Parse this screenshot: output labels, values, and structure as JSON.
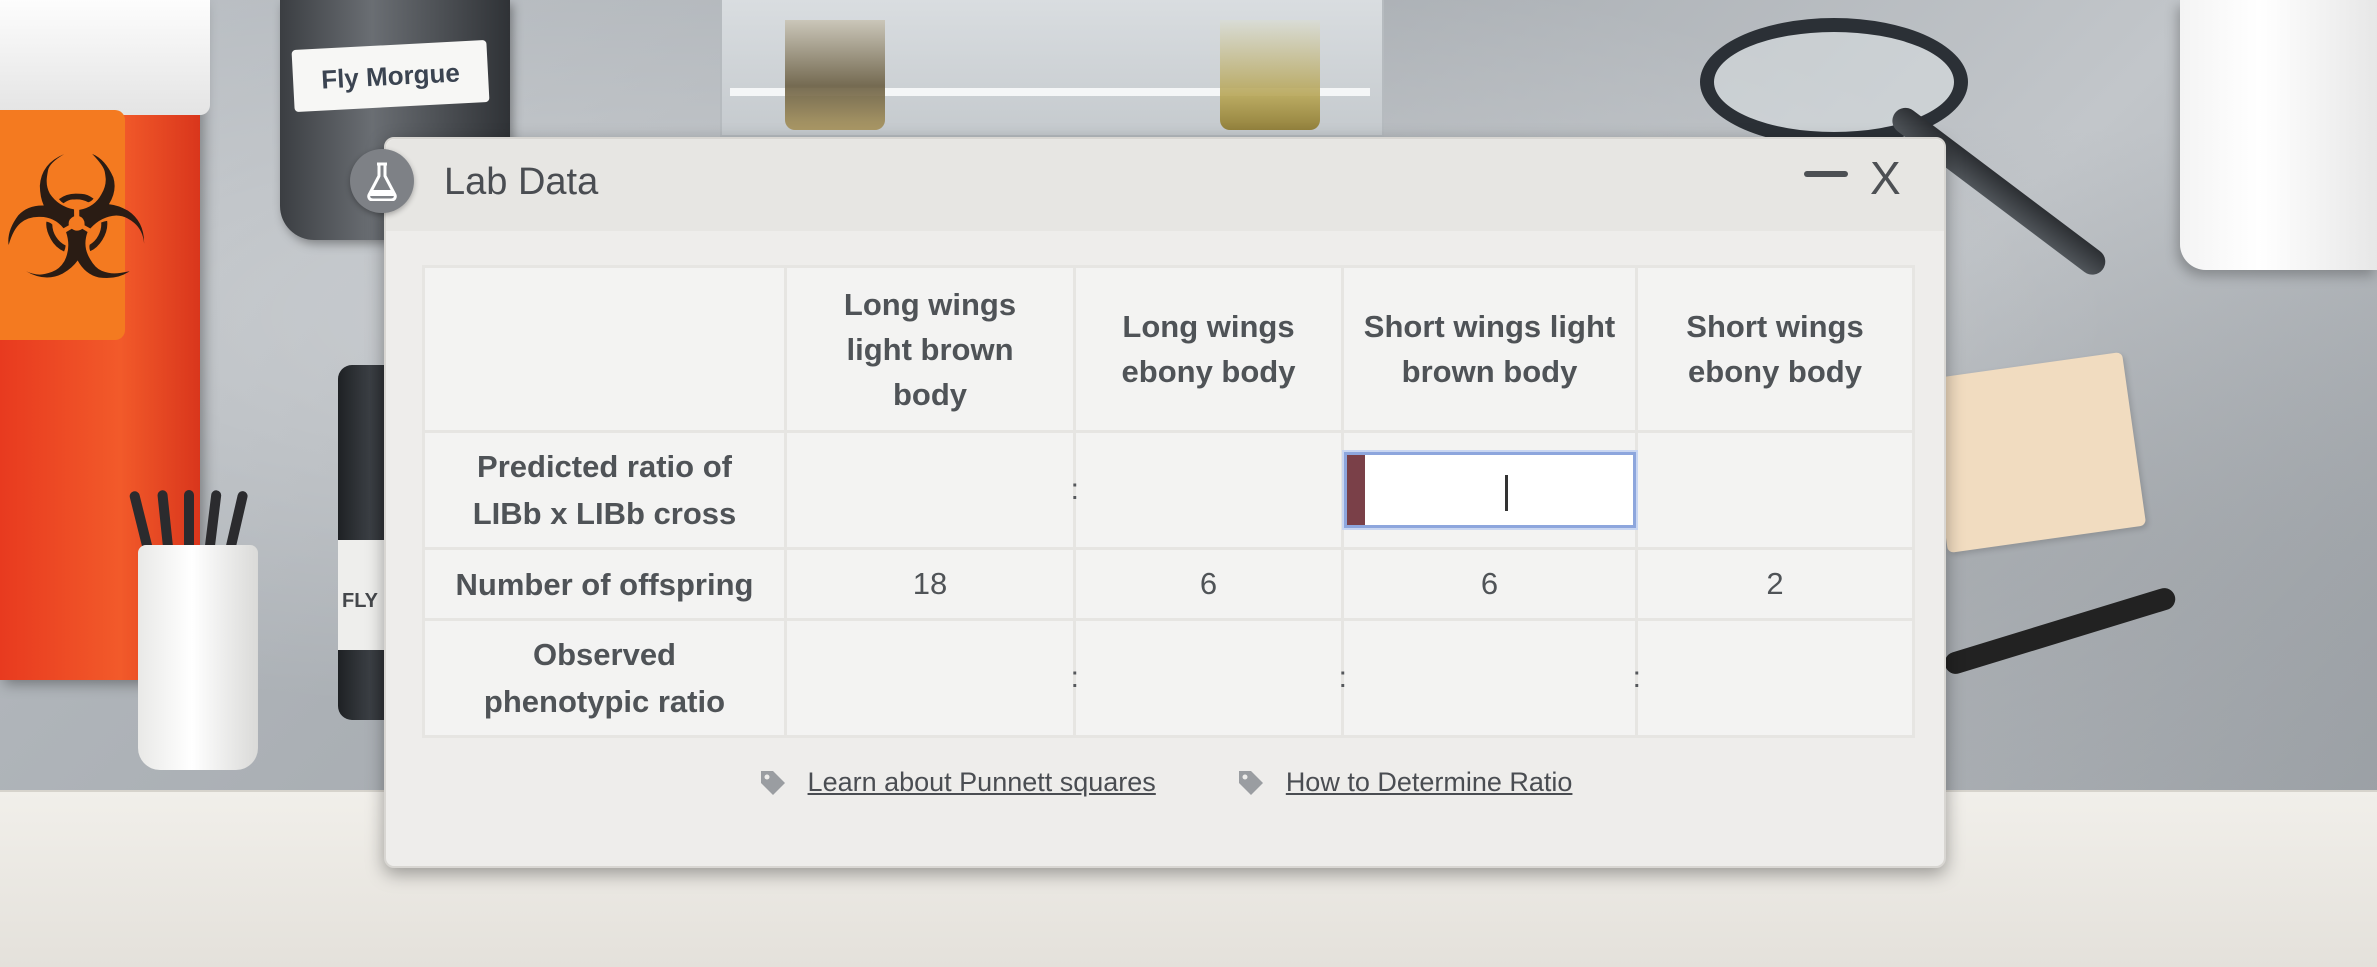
{
  "background": {
    "morgue_label": "Fly Morgue",
    "bottle_label": "FLY"
  },
  "dialog": {
    "title": "Lab Data",
    "icon": "flask-icon",
    "minimize_label": "—",
    "close_label": "X"
  },
  "table": {
    "columns": [
      "Long wings light brown body",
      "Long wings ebony body",
      "Short wings light brown body",
      "Short wings ebony body"
    ],
    "rows": {
      "predicted": {
        "label": "Predicted ratio of LIBb x LIBb cross",
        "values": [
          "",
          "",
          "",
          ""
        ]
      },
      "offspring": {
        "label": "Number of offspring",
        "values": [
          "18",
          "6",
          "6",
          "2"
        ]
      },
      "observed": {
        "label": "Observed phenotypic ratio",
        "values": [
          "",
          "",
          "",
          ""
        ]
      }
    },
    "separator": ":"
  },
  "links": {
    "punnett": "Learn about Punnett squares",
    "ratio": "How to Determine Ratio"
  },
  "colors": {
    "accent_input_border": "#8da6dd",
    "input_marker": "#7a4048"
  }
}
